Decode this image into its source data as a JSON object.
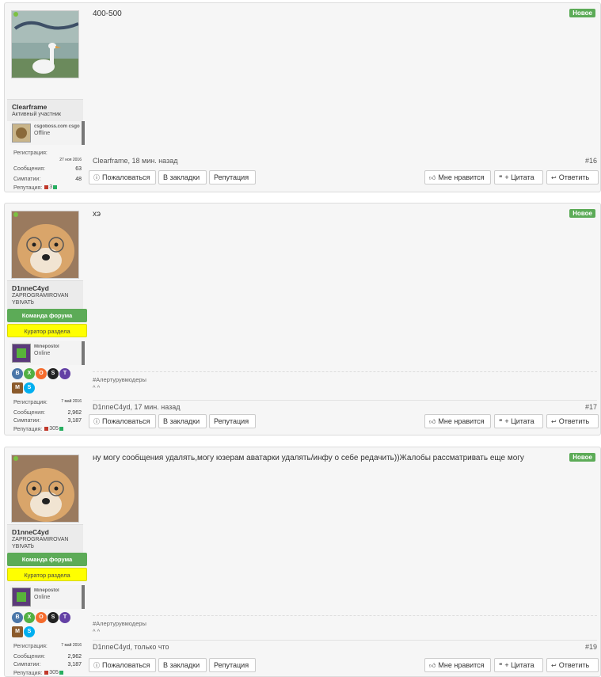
{
  "labels": {
    "new": "Новое",
    "report": "Пожаловаться",
    "bookmark": "В закладки",
    "reputation": "Репутация",
    "like": "Мне нравится",
    "quote": "+ Цитата",
    "reply": "Ответить",
    "reg": "Регистрация:",
    "messages": "Сообщения:",
    "likes": "Симпатии:",
    "rep": "Репутация:"
  },
  "posts": [
    {
      "username": "Clearframe",
      "usertitle": "Активный участник",
      "steam_name": "csgoboss.com csgo",
      "steam_status": "Offline",
      "reg_date": "27 ноя 2016",
      "messages": "63",
      "likes": "48",
      "rep": "3",
      "message": "400-500",
      "meta": "Clearframe, 18 мин. назад",
      "number": "#16"
    },
    {
      "username": "D1nneC4yd",
      "usertitle": "ZAPROGRAMIROVAN YBIVATb",
      "team_banner": "Команда форума",
      "curator_banner": "Куратор раздела",
      "steam_name": "Minepostol",
      "steam_status": "Online",
      "reg_date": "7 май 2016",
      "messages": "2,962",
      "likes": "3,187",
      "rep": "305",
      "message": "хэ",
      "signature_line1": "#Алертурувмодеры",
      "signature_line2": "^ ^",
      "meta": "D1nneC4yd, 17 мин. назад",
      "number": "#17"
    },
    {
      "username": "D1nneC4yd",
      "usertitle": "ZAPROGRAMIROVAN YBIVATb",
      "team_banner": "Команда форума",
      "curator_banner": "Куратор раздела",
      "steam_name": "Minepostol",
      "steam_status": "Online",
      "reg_date": "7 май 2016",
      "messages": "2,962",
      "likes": "3,187",
      "rep": "305",
      "message": "ну могу сообщения удалять,могу юзерам аватарки удалять/инфу о себе редачить))Жалобы рассматривать еще могу",
      "signature_line1": "#Алертурувмодеры",
      "signature_line2": "^ ^",
      "meta": "D1nneC4yd, только что",
      "number": "#19"
    }
  ],
  "colors": {
    "accent_green": "#5cab57",
    "curator_yellow": "#ffff00",
    "online": "#7cc142"
  }
}
